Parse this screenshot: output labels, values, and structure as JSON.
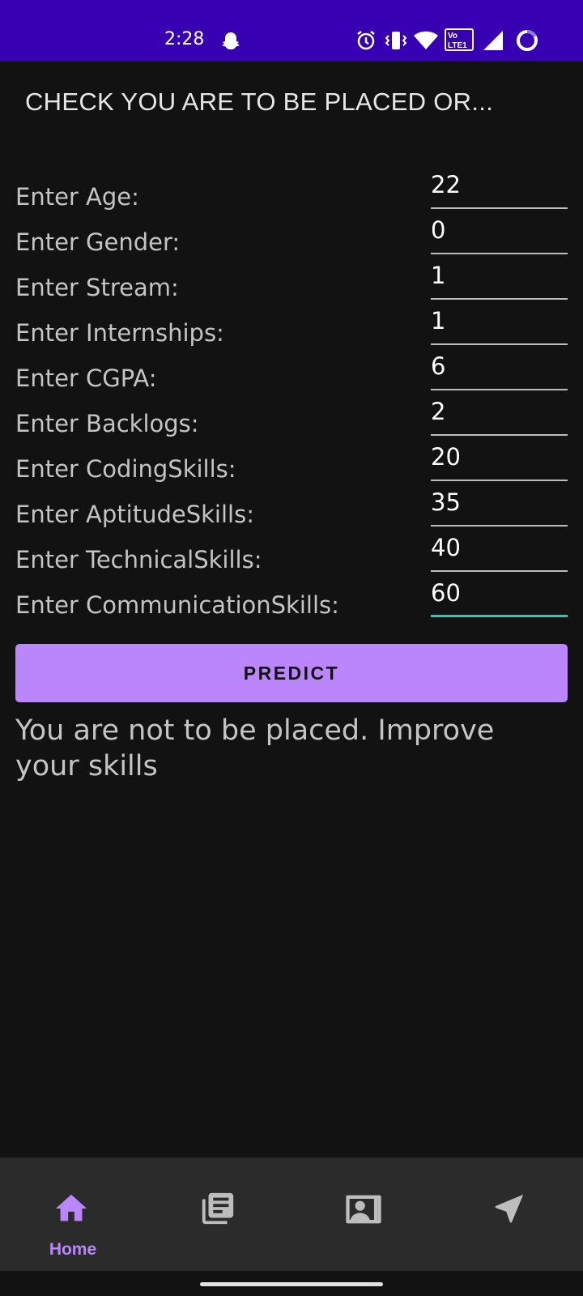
{
  "status_bar": {
    "time": "2:28",
    "background": "#3700b3",
    "icons": [
      "snapchat-icon",
      "alarm-icon",
      "vibrate-icon",
      "wifi-icon",
      "volte-icon",
      "signal-icon",
      "battery-icon"
    ],
    "volte_text": "Vo LTE1"
  },
  "app": {
    "title": "CHECK YOU ARE TO BE  PLACED OR..."
  },
  "form": {
    "rows": [
      {
        "label": "Enter Age:",
        "value": "22"
      },
      {
        "label": "Enter Gender:",
        "value": "0"
      },
      {
        "label": "Enter Stream:",
        "value": "1"
      },
      {
        "label": "Enter Internships:",
        "value": "1"
      },
      {
        "label": "Enter CGPA:",
        "value": "6"
      },
      {
        "label": "Enter Backlogs:",
        "value": "2"
      },
      {
        "label": "Enter CodingSkills:",
        "value": "20"
      },
      {
        "label": "Enter AptitudeSkills:",
        "value": "35"
      },
      {
        "label": "Enter TechnicalSkills:",
        "value": "40"
      },
      {
        "label": "Enter CommunicationSkills:",
        "value": "60"
      }
    ],
    "focus_color": "#1ecdbc"
  },
  "predict_button": {
    "label": "PREDICT",
    "color": "#bb86fc"
  },
  "result": {
    "text": "You are not to be placed. Improve your skills"
  },
  "bottom_nav": {
    "items": [
      {
        "icon": "home-icon",
        "label": "Home",
        "active": true
      },
      {
        "icon": "library-books-icon",
        "label": "",
        "active": false
      },
      {
        "icon": "contact-card-icon",
        "label": "",
        "active": false
      },
      {
        "icon": "navigation-arrow-icon",
        "label": "",
        "active": false
      }
    ],
    "active_color": "#bb86fc",
    "inactive_color": "#bdbdbd"
  }
}
